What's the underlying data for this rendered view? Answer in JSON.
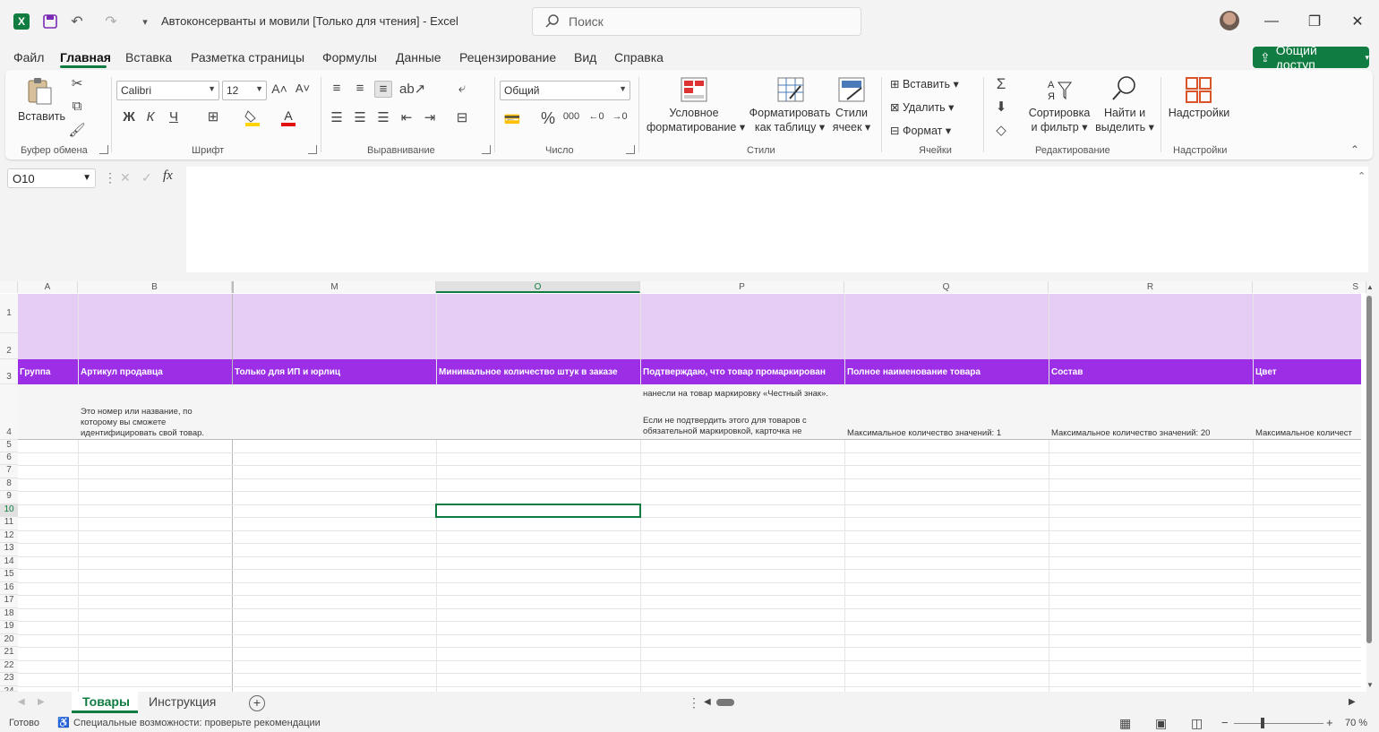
{
  "titlebar": {
    "title": "Автоконсерванты и мовили  [Только для чтения]  -  Excel",
    "search_placeholder": "Поиск",
    "icons": [
      "excel-logo-icon",
      "save-icon",
      "undo-icon",
      "redo-icon",
      "customize-qat-icon"
    ]
  },
  "menu": {
    "tabs": [
      "Файл",
      "Главная",
      "Вставка",
      "Разметка страницы",
      "Формулы",
      "Данные",
      "Рецензирование",
      "Вид",
      "Справка"
    ],
    "active": "Главная",
    "share_label": "Общий доступ"
  },
  "ribbon": {
    "clipboard": {
      "paste_label": "Вставить",
      "group_label": "Буфер обмена"
    },
    "font": {
      "font_name": "Calibri",
      "font_size": "12",
      "bold": "Ж",
      "italic": "К",
      "underline": "Ч",
      "group_label": "Шрифт"
    },
    "alignment": {
      "group_label": "Выравнивание"
    },
    "number": {
      "format": "Общий",
      "group_label": "Число"
    },
    "styles": {
      "conditional_1": "Условное",
      "conditional_2": "форматирование",
      "table_1": "Форматировать",
      "table_2": "как таблицу",
      "cell_1": "Стили",
      "cell_2": "ячеек",
      "group_label": "Стили"
    },
    "cells": {
      "insert": "Вставить",
      "delete": "Удалить",
      "format": "Формат",
      "group_label": "Ячейки"
    },
    "editing": {
      "sort_1": "Сортировка",
      "sort_2": "и фильтр",
      "find_1": "Найти и",
      "find_2": "выделить",
      "group_label": "Редактирование"
    },
    "addins": {
      "label": "Надстройки",
      "group_label": "Надстройки"
    }
  },
  "formula_bar": {
    "name_box": "O10",
    "formula": ""
  },
  "grid": {
    "columns": [
      "A",
      "B",
      "M",
      "O",
      "P",
      "Q",
      "R",
      "S"
    ],
    "selected_column": "O",
    "rows": [
      "1",
      "2",
      "3",
      "4",
      "5",
      "6",
      "7",
      "8",
      "9",
      "10",
      "11",
      "12",
      "13",
      "14",
      "15",
      "16",
      "17",
      "18",
      "19",
      "20",
      "21",
      "22",
      "23",
      "24"
    ],
    "selected_row": "10",
    "header_row": [
      "Группа",
      "Артикул продавца",
      "Только для ИП и юрлиц",
      "Минимальное количество штук в заказе",
      "Подтверждаю, что товар промаркирован",
      "Полное наименование товара",
      "Состав",
      "Цвет"
    ],
    "desc_b": "Это номер или название, по которому вы сможете идентифицировать свой товар.",
    "desc_p1": "нанесли на товар маркировку «Честный знак».",
    "desc_p2": "Если не подтвердить этого для товаров с обязательной маркировкой, карточка не",
    "desc_q": "Максимальное количество значений: 1",
    "desc_r": "Максимальное количество значений: 20",
    "desc_s": "Максимальное количест"
  },
  "sheets": {
    "tabs": [
      "Товары",
      "Инструкция"
    ],
    "active": "Товары"
  },
  "status": {
    "ready": "Готово",
    "accessibility": "Специальные возможности: проверьте рекомендации",
    "zoom": "70 %"
  },
  "colors": {
    "accent": "#107c41",
    "purple_band": "#e6cdf5",
    "purple_header": "#9c2ee6"
  }
}
